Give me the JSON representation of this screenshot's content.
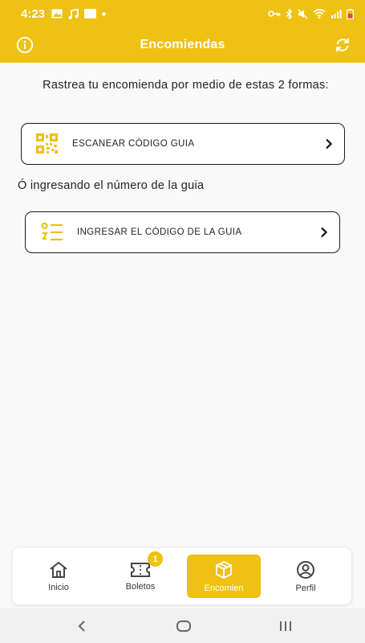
{
  "status_bar": {
    "time": "4:23",
    "left_icons": [
      "image-icon",
      "music-note-icon",
      "app-square-icon",
      "dot-icon"
    ],
    "right_icons": [
      "key-icon",
      "bluetooth-icon",
      "mute-icon",
      "wifi-icon",
      "signal-icon",
      "battery-icon"
    ]
  },
  "header": {
    "title": "Encomiendas",
    "left_icon": "info-icon",
    "right_icon": "refresh-icon",
    "background": "#eec113"
  },
  "main": {
    "intro": "Rastrea tu encomienda por medio de estas 2 formas:",
    "scan_option": {
      "label": "ESCANEAR CÓDIGO GUIA",
      "icon": "qr-code-icon"
    },
    "or_text": "Ó ingresando el número de la guia",
    "code_option": {
      "label": "INGRESAR EL CÓDIGO DE LA GUIA",
      "icon": "list-code-icon"
    }
  },
  "bottom_nav": {
    "items": [
      {
        "label": "Inicio",
        "icon": "home-icon"
      },
      {
        "label": "Boletos",
        "icon": "ticket-icon",
        "badge": "1"
      },
      {
        "label": "Encomien",
        "icon": "package-icon",
        "active": true
      },
      {
        "label": "Perfil",
        "icon": "profile-icon"
      }
    ],
    "accent": "#eec113"
  },
  "android_nav": [
    "back-icon",
    "home-circle-icon",
    "recents-icon"
  ]
}
